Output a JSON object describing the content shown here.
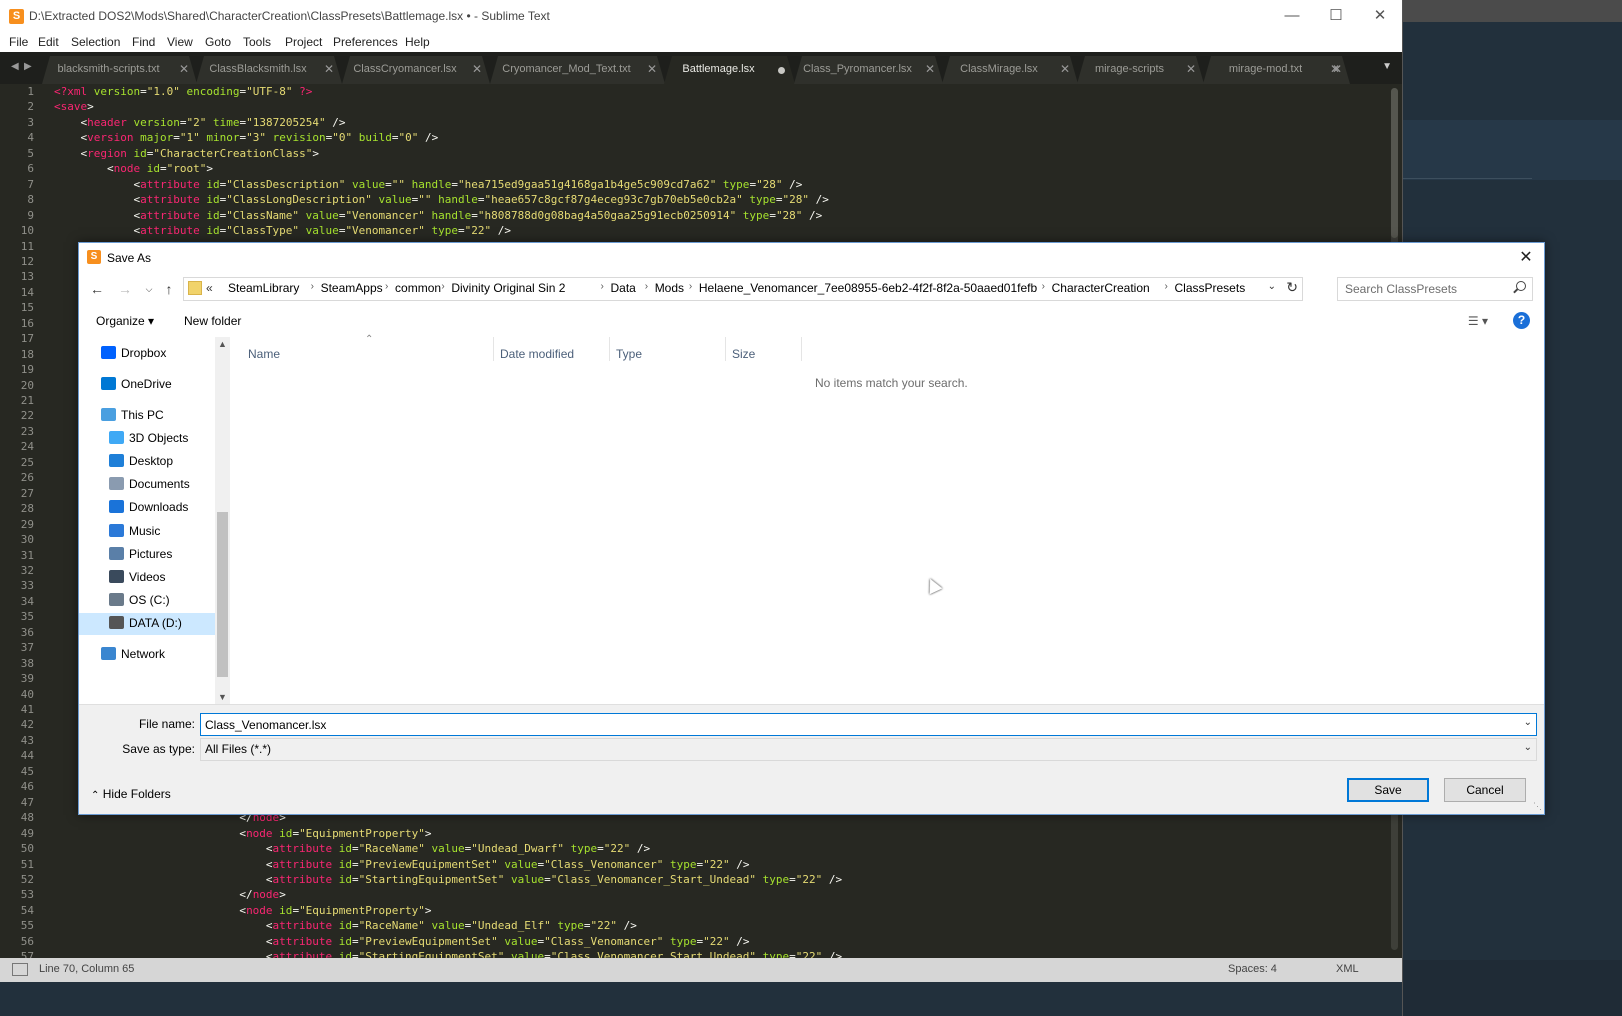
{
  "window": {
    "title": "D:\\Extracted DOS2\\Mods\\Shared\\CharacterCreation\\ClassPresets\\Battlemage.lsx • - Sublime Text",
    "icon": "sublime-icon"
  },
  "menu": [
    "File",
    "Edit",
    "Selection",
    "Find",
    "View",
    "Goto",
    "Tools",
    "Project",
    "Preferences",
    "Help"
  ],
  "tabs": [
    {
      "label": "blacksmith-scripts.txt",
      "active": false
    },
    {
      "label": "ClassBlacksmith.lsx",
      "active": false
    },
    {
      "label": "ClassCryomancer.lsx",
      "active": false
    },
    {
      "label": "Cryomancer_Mod_Text.txt",
      "active": false
    },
    {
      "label": "Battlemage.lsx",
      "active": true,
      "dirty": true
    },
    {
      "label": "Class_Pyromancer.lsx",
      "active": false
    },
    {
      "label": "ClassMirage.lsx",
      "active": false
    },
    {
      "label": "mirage-scripts",
      "active": false
    },
    {
      "label": "mirage-mod.txt",
      "active": false
    }
  ],
  "editor": {
    "lines_top": [
      "1",
      "2",
      "3",
      "4",
      "5",
      "6",
      "7",
      "8",
      "9",
      "10",
      "11",
      "12",
      "13",
      "14",
      "15",
      "16",
      "17",
      "18",
      "19",
      "20",
      "21",
      "22",
      "23",
      "24",
      "25",
      "26",
      "27",
      "28",
      "29",
      "30",
      "31",
      "32",
      "33",
      "34",
      "35",
      "36",
      "37",
      "38",
      "39",
      "40",
      "41",
      "42",
      "43",
      "44",
      "45",
      "46",
      "47",
      "48",
      "49",
      "50",
      "51",
      "52",
      "53",
      "54",
      "55",
      "56",
      "57"
    ],
    "code_top": [
      [
        [
          "t",
          "<?xml"
        ],
        [
          "a",
          " version"
        ],
        [
          "p",
          "="
        ],
        [
          "s",
          "\"1.0\""
        ],
        [
          "a",
          " encoding"
        ],
        [
          "p",
          "="
        ],
        [
          "s",
          "\"UTF-8\""
        ],
        [
          "t",
          " ?>"
        ]
      ],
      [
        [
          "t",
          "<save"
        ],
        [
          "p",
          ">"
        ]
      ],
      [
        [
          "p",
          "    <"
        ],
        [
          "t",
          "header"
        ],
        [
          "a",
          " version"
        ],
        [
          "p",
          "="
        ],
        [
          "s",
          "\"2\""
        ],
        [
          "a",
          " time"
        ],
        [
          "p",
          "="
        ],
        [
          "s",
          "\"1387205254\""
        ],
        [
          "p",
          " />"
        ]
      ],
      [
        [
          "p",
          "    <"
        ],
        [
          "t",
          "version"
        ],
        [
          "a",
          " major"
        ],
        [
          "p",
          "="
        ],
        [
          "s",
          "\"1\""
        ],
        [
          "a",
          " minor"
        ],
        [
          "p",
          "="
        ],
        [
          "s",
          "\"3\""
        ],
        [
          "a",
          " revision"
        ],
        [
          "p",
          "="
        ],
        [
          "s",
          "\"0\""
        ],
        [
          "a",
          " build"
        ],
        [
          "p",
          "="
        ],
        [
          "s",
          "\"0\""
        ],
        [
          "p",
          " />"
        ]
      ],
      [
        [
          "p",
          "    <"
        ],
        [
          "t",
          "region"
        ],
        [
          "a",
          " id"
        ],
        [
          "p",
          "="
        ],
        [
          "s",
          "\"CharacterCreationClass\""
        ],
        [
          "p",
          ">"
        ]
      ],
      [
        [
          "p",
          "        <"
        ],
        [
          "t",
          "node"
        ],
        [
          "a",
          " id"
        ],
        [
          "p",
          "="
        ],
        [
          "s",
          "\"root\""
        ],
        [
          "p",
          ">"
        ]
      ],
      [
        [
          "p",
          "            <"
        ],
        [
          "t",
          "attribute"
        ],
        [
          "a",
          " id"
        ],
        [
          "p",
          "="
        ],
        [
          "s",
          "\"ClassDescription\""
        ],
        [
          "a",
          " value"
        ],
        [
          "p",
          "="
        ],
        [
          "s",
          "\"\""
        ],
        [
          "a",
          " handle"
        ],
        [
          "p",
          "="
        ],
        [
          "s",
          "\"hea715ed9gaa51g4168ga1b4ge5c909cd7a62\""
        ],
        [
          "a",
          " type"
        ],
        [
          "p",
          "="
        ],
        [
          "s",
          "\"28\""
        ],
        [
          "p",
          " />"
        ]
      ],
      [
        [
          "p",
          "            <"
        ],
        [
          "t",
          "attribute"
        ],
        [
          "a",
          " id"
        ],
        [
          "p",
          "="
        ],
        [
          "s",
          "\"ClassLongDescription\""
        ],
        [
          "a",
          " value"
        ],
        [
          "p",
          "="
        ],
        [
          "s",
          "\"\""
        ],
        [
          "a",
          " handle"
        ],
        [
          "p",
          "="
        ],
        [
          "s",
          "\"heae657c8gcf87g4eceg93c7gb70eb5e0cb2a\""
        ],
        [
          "a",
          " type"
        ],
        [
          "p",
          "="
        ],
        [
          "s",
          "\"28\""
        ],
        [
          "p",
          " />"
        ]
      ],
      [
        [
          "p",
          "            <"
        ],
        [
          "t",
          "attribute"
        ],
        [
          "a",
          " id"
        ],
        [
          "p",
          "="
        ],
        [
          "s",
          "\"ClassName\""
        ],
        [
          "a",
          " value"
        ],
        [
          "p",
          "="
        ],
        [
          "s",
          "\"Venomancer\""
        ],
        [
          "a",
          " handle"
        ],
        [
          "p",
          "="
        ],
        [
          "s",
          "\"h808788d0g08bag4a50gaa25g91ecb0250914\""
        ],
        [
          "a",
          " type"
        ],
        [
          "p",
          "="
        ],
        [
          "s",
          "\"28\""
        ],
        [
          "p",
          " />"
        ]
      ],
      [
        [
          "p",
          "            <"
        ],
        [
          "t",
          "attribute"
        ],
        [
          "a",
          " id"
        ],
        [
          "p",
          "="
        ],
        [
          "s",
          "\"ClassType\""
        ],
        [
          "a",
          " value"
        ],
        [
          "p",
          "="
        ],
        [
          "s",
          "\"Venomancer\""
        ],
        [
          "a",
          " type"
        ],
        [
          "p",
          "="
        ],
        [
          "s",
          "\"22\""
        ],
        [
          "p",
          " />"
        ]
      ]
    ],
    "code_bottom": [
      [
        [
          "p",
          "                            </"
        ],
        [
          "t",
          "node"
        ],
        [
          "p",
          ">"
        ]
      ],
      [
        [
          "p",
          "                            <"
        ],
        [
          "t",
          "node"
        ],
        [
          "a",
          " id"
        ],
        [
          "p",
          "="
        ],
        [
          "s",
          "\"EquipmentProperty\""
        ],
        [
          "p",
          ">"
        ]
      ],
      [
        [
          "p",
          "                                <"
        ],
        [
          "t",
          "attribute"
        ],
        [
          "a",
          " id"
        ],
        [
          "p",
          "="
        ],
        [
          "s",
          "\"RaceName\""
        ],
        [
          "a",
          " value"
        ],
        [
          "p",
          "="
        ],
        [
          "s",
          "\"Undead_Dwarf\""
        ],
        [
          "a",
          " type"
        ],
        [
          "p",
          "="
        ],
        [
          "s",
          "\"22\""
        ],
        [
          "p",
          " />"
        ]
      ],
      [
        [
          "p",
          "                                <"
        ],
        [
          "t",
          "attribute"
        ],
        [
          "a",
          " id"
        ],
        [
          "p",
          "="
        ],
        [
          "s",
          "\"PreviewEquipmentSet\""
        ],
        [
          "a",
          " value"
        ],
        [
          "p",
          "="
        ],
        [
          "s",
          "\"Class_Venomancer\""
        ],
        [
          "a",
          " type"
        ],
        [
          "p",
          "="
        ],
        [
          "s",
          "\"22\""
        ],
        [
          "p",
          " />"
        ]
      ],
      [
        [
          "p",
          "                                <"
        ],
        [
          "t",
          "attribute"
        ],
        [
          "a",
          " id"
        ],
        [
          "p",
          "="
        ],
        [
          "s",
          "\"StartingEquipmentSet\""
        ],
        [
          "a",
          " value"
        ],
        [
          "p",
          "="
        ],
        [
          "s",
          "\"Class_Venomancer_Start_Undead\""
        ],
        [
          "a",
          " type"
        ],
        [
          "p",
          "="
        ],
        [
          "s",
          "\"22\""
        ],
        [
          "p",
          " />"
        ]
      ],
      [
        [
          "p",
          "                            </"
        ],
        [
          "t",
          "node"
        ],
        [
          "p",
          ">"
        ]
      ],
      [
        [
          "p",
          "                            <"
        ],
        [
          "t",
          "node"
        ],
        [
          "a",
          " id"
        ],
        [
          "p",
          "="
        ],
        [
          "s",
          "\"EquipmentProperty\""
        ],
        [
          "p",
          ">"
        ]
      ],
      [
        [
          "p",
          "                                <"
        ],
        [
          "t",
          "attribute"
        ],
        [
          "a",
          " id"
        ],
        [
          "p",
          "="
        ],
        [
          "s",
          "\"RaceName\""
        ],
        [
          "a",
          " value"
        ],
        [
          "p",
          "="
        ],
        [
          "s",
          "\"Undead_Elf\""
        ],
        [
          "a",
          " type"
        ],
        [
          "p",
          "="
        ],
        [
          "s",
          "\"22\""
        ],
        [
          "p",
          " />"
        ]
      ],
      [
        [
          "p",
          "                                <"
        ],
        [
          "t",
          "attribute"
        ],
        [
          "a",
          " id"
        ],
        [
          "p",
          "="
        ],
        [
          "s",
          "\"PreviewEquipmentSet\""
        ],
        [
          "a",
          " value"
        ],
        [
          "p",
          "="
        ],
        [
          "s",
          "\"Class_Venomancer\""
        ],
        [
          "a",
          " type"
        ],
        [
          "p",
          "="
        ],
        [
          "s",
          "\"22\""
        ],
        [
          "p",
          " />"
        ]
      ],
      [
        [
          "p",
          "                                <"
        ],
        [
          "t",
          "attribute"
        ],
        [
          "a",
          " id"
        ],
        [
          "p",
          "="
        ],
        [
          "s",
          "\"StartingEquipmentSet\""
        ],
        [
          "a",
          " value"
        ],
        [
          "p",
          "="
        ],
        [
          "s",
          "\"Class_Venomancer_Start_Undead\""
        ],
        [
          "a",
          " type"
        ],
        [
          "p",
          "="
        ],
        [
          "s",
          "\"22\""
        ],
        [
          "p",
          " />"
        ]
      ]
    ]
  },
  "status": {
    "position": "Line 70, Column 65",
    "spaces": "Spaces: 4",
    "syntax": "XML"
  },
  "dialog": {
    "title": "Save As",
    "address": {
      "overflow": "«",
      "crumbs": [
        "SteamLibrary",
        "SteamApps",
        "common",
        "Divinity Original Sin 2",
        "Data",
        "Mods",
        "Helaene_Venomancer_7ee08955-6eb2-4f2f-8f2a-50aaed01fefb",
        "CharacterCreation",
        "ClassPresets"
      ]
    },
    "search_placeholder": "Search ClassPresets",
    "toolbar": {
      "organize": "Organize ▾",
      "new_folder": "New folder",
      "help": "?"
    },
    "nav": [
      {
        "label": "Dropbox",
        "icon": "dropbox-icon",
        "color": "#0061fe"
      },
      {
        "label": "OneDrive",
        "icon": "onedrive-icon",
        "color": "#0078d4"
      },
      {
        "label": "This PC",
        "icon": "computer-icon",
        "color": "#4a9fe0"
      },
      {
        "label": "3D Objects",
        "icon": "cube-icon",
        "color": "#3fa9f5"
      },
      {
        "label": "Desktop",
        "icon": "desktop-icon",
        "color": "#1e7fd8"
      },
      {
        "label": "Documents",
        "icon": "documents-icon",
        "color": "#8a9bb0"
      },
      {
        "label": "Downloads",
        "icon": "download-icon",
        "color": "#1a73d9"
      },
      {
        "label": "Music",
        "icon": "music-icon",
        "color": "#2b79d8"
      },
      {
        "label": "Pictures",
        "icon": "pictures-icon",
        "color": "#5a7fa8"
      },
      {
        "label": "Videos",
        "icon": "videos-icon",
        "color": "#3a4a5c"
      },
      {
        "label": "OS (C:)",
        "icon": "drive-c-icon",
        "color": "#6a7a8a"
      },
      {
        "label": "DATA (D:)",
        "icon": "drive-d-icon",
        "color": "#555555",
        "selected": true
      },
      {
        "label": "Network",
        "icon": "network-icon",
        "color": "#3a86d0"
      }
    ],
    "columns": [
      "Name",
      "Date modified",
      "Type",
      "Size"
    ],
    "empty_message": "No items match your search.",
    "file_name_label": "File name:",
    "file_name_value": "Class_Venomancer.lsx",
    "save_type_label": "Save as type:",
    "save_type_value": "All Files (*.*)",
    "hide_folders": "Hide Folders",
    "save_button": "Save",
    "cancel_button": "Cancel"
  }
}
